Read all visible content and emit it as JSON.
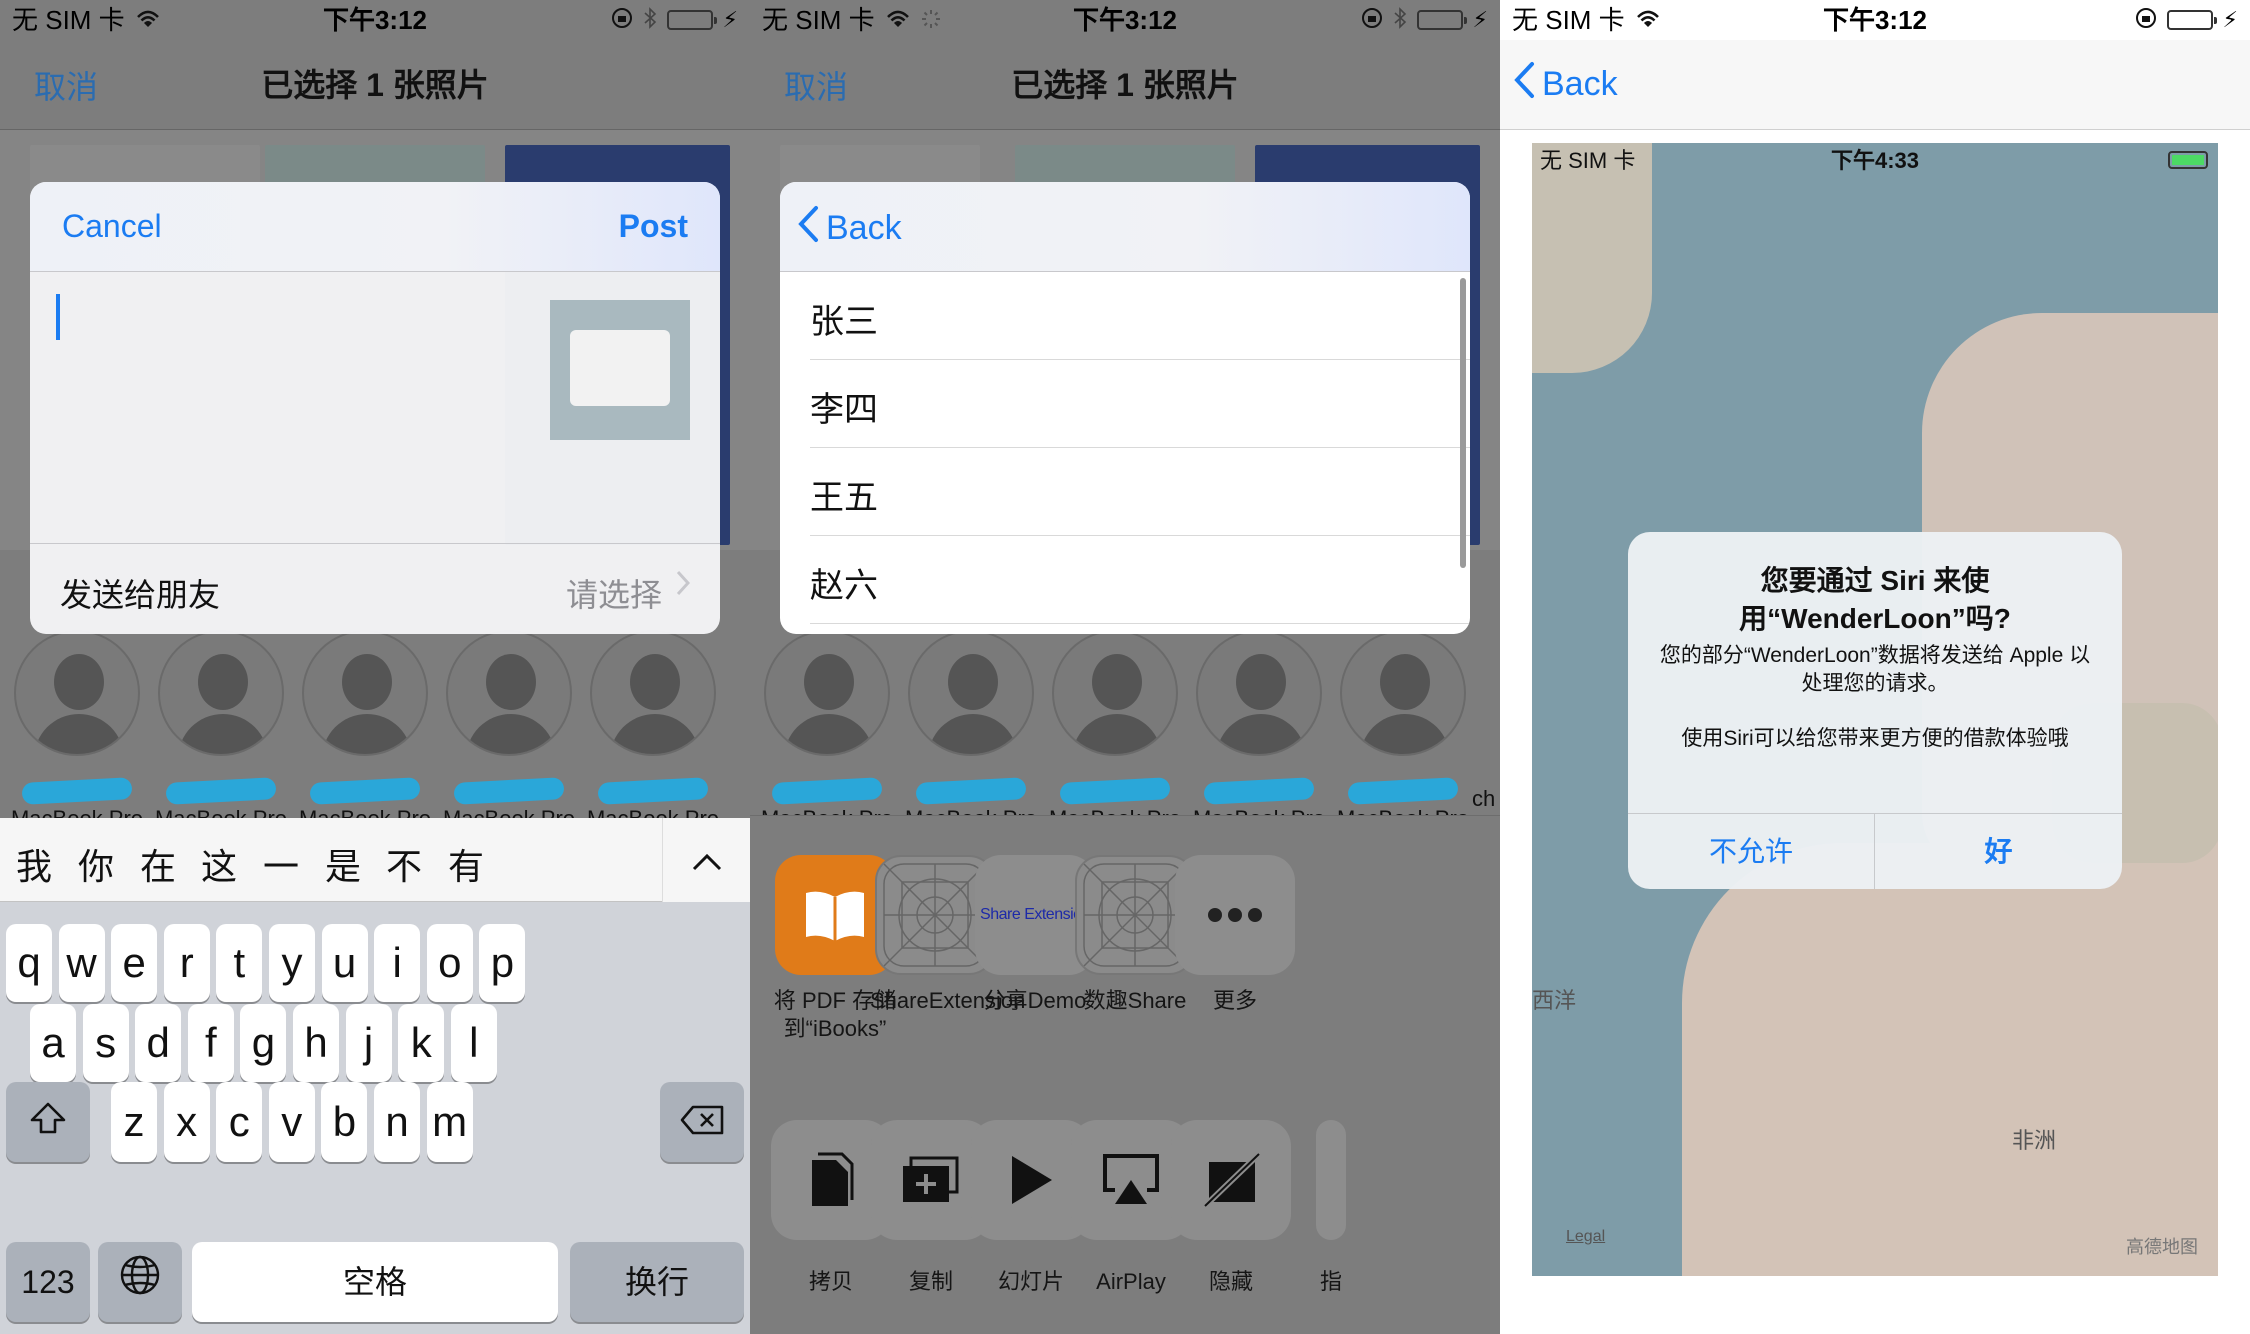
{
  "status_bar": {
    "panel1": {
      "carrier": "无 SIM 卡",
      "time": "下午3:12"
    },
    "panel2": {
      "carrier": "无 SIM 卡",
      "time": "下午3:12"
    },
    "panel3": {
      "carrier": "无 SIM 卡",
      "time": "下午3:12"
    }
  },
  "share_nav": {
    "cancel": "取消",
    "title": "已选择 1 张照片"
  },
  "compose": {
    "cancel": "Cancel",
    "post": "Post",
    "row_label": "发送给朋友",
    "row_value": "请选择"
  },
  "contacts": {
    "device_label": "MacBook Pro",
    "partial_label": "ch"
  },
  "keyboard": {
    "candidates": [
      "我",
      "你",
      "在",
      "这",
      "一",
      "是",
      "不",
      "有"
    ],
    "row1": [
      "q",
      "w",
      "e",
      "r",
      "t",
      "y",
      "u",
      "i",
      "o",
      "p"
    ],
    "row2": [
      "a",
      "s",
      "d",
      "f",
      "g",
      "h",
      "j",
      "k",
      "l"
    ],
    "row3": [
      "z",
      "x",
      "c",
      "v",
      "b",
      "n",
      "m"
    ],
    "num_key": "123",
    "space": "空格",
    "return": "换行"
  },
  "friend_list": {
    "back": "Back",
    "items": [
      "张三",
      "李四",
      "王五",
      "赵六"
    ]
  },
  "share_apps": [
    {
      "label": "将 PDF 存储到“iBooks”",
      "icon": "ibooks-icon"
    },
    {
      "label": "ShareExtension",
      "icon": "placeholder-app-icon"
    },
    {
      "label": "分享Demo",
      "icon": "share-extension-icon",
      "icon_text": "Share Extension"
    },
    {
      "label": "数趣Share",
      "icon": "placeholder-app-icon"
    },
    {
      "label": "更多",
      "icon": "more-icon"
    }
  ],
  "share_actions": [
    {
      "label": "拷贝",
      "icon": "copy-icon"
    },
    {
      "label": "复制",
      "icon": "duplicate-icon"
    },
    {
      "label": "幻灯片",
      "icon": "play-icon"
    },
    {
      "label": "AirPlay",
      "icon": "airplay-icon"
    },
    {
      "label": "隐藏",
      "icon": "hide-icon"
    },
    {
      "label": "指",
      "icon": "partial-icon"
    }
  ],
  "detail_nav": {
    "back": "Back"
  },
  "screenshot": {
    "carrier": "无 SIM 卡",
    "time": "下午4:33",
    "map_labels": {
      "ocean": "西洋",
      "africa": "非洲",
      "legal": "Legal",
      "provider": "高德地图"
    },
    "alert": {
      "title": "您要通过 Siri 来使用“WenderLoon”吗?",
      "message": "您的部分“WenderLoon”数据将发送给 Apple 以处理您的请求。",
      "message2": "使用Siri可以给您带来更方便的借款体验哦",
      "deny": "不允许",
      "ok": "好"
    }
  },
  "colors": {
    "ios_blue": "#1b7cf2",
    "battery_green": "#4cd964",
    "dim_overlay": "#7d7d7d"
  }
}
